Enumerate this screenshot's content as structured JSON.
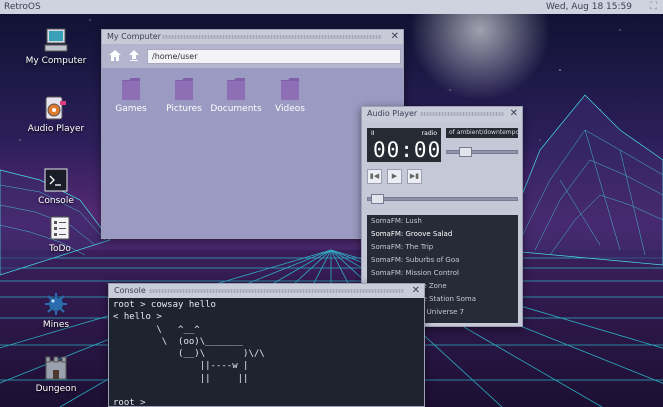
{
  "topbar": {
    "brand": "RetroOS",
    "clock": "Wed, Aug 18 15:59",
    "fullscreen_icon": "fullscreen-icon"
  },
  "desktop_icons": [
    {
      "label": "My Computer",
      "icon": "computer-icon"
    },
    {
      "label": "Audio Player",
      "icon": "audio-player-icon"
    },
    {
      "label": "Console",
      "icon": "console-icon"
    },
    {
      "label": "ToDo",
      "icon": "todo-icon"
    },
    {
      "label": "Mines",
      "icon": "mines-icon"
    },
    {
      "label": "Dungeon",
      "icon": "dungeon-icon"
    }
  ],
  "file_manager": {
    "title": "My Computer",
    "path": "/home/user",
    "folders": [
      "Games",
      "Pictures",
      "Documents",
      "Videos"
    ]
  },
  "audio_player": {
    "title": "Audio Player",
    "status": "II",
    "mode": "radio",
    "time": "00:00",
    "ticker": "of ambient/downtempo",
    "volume": 0.22,
    "progress": 0.03,
    "playlist": [
      "SomaFM: Lush",
      "SomaFM: Groove Salad",
      "SomaFM: The Trip",
      "SomaFM: Suburbs of Goa",
      "SomaFM: Mission Control",
      "SomaFM: Drone Zone",
      "SomaFM: Space Station Soma",
      "SomaFM: Sonic Universe 7"
    ],
    "active_index": 1
  },
  "console": {
    "title": "Console",
    "lines": [
      "root > cowsay hello",
      "< hello >",
      "        \\   ^__^",
      "         \\  (oo)\\_______",
      "            (__)\\       )\\/\\",
      "                ||----w |",
      "                ||     ||",
      "",
      "root > "
    ]
  },
  "colors": {
    "accent": "#9b9ac2",
    "folder": "#8e6fb5",
    "terminal_bg": "#1d2430"
  }
}
